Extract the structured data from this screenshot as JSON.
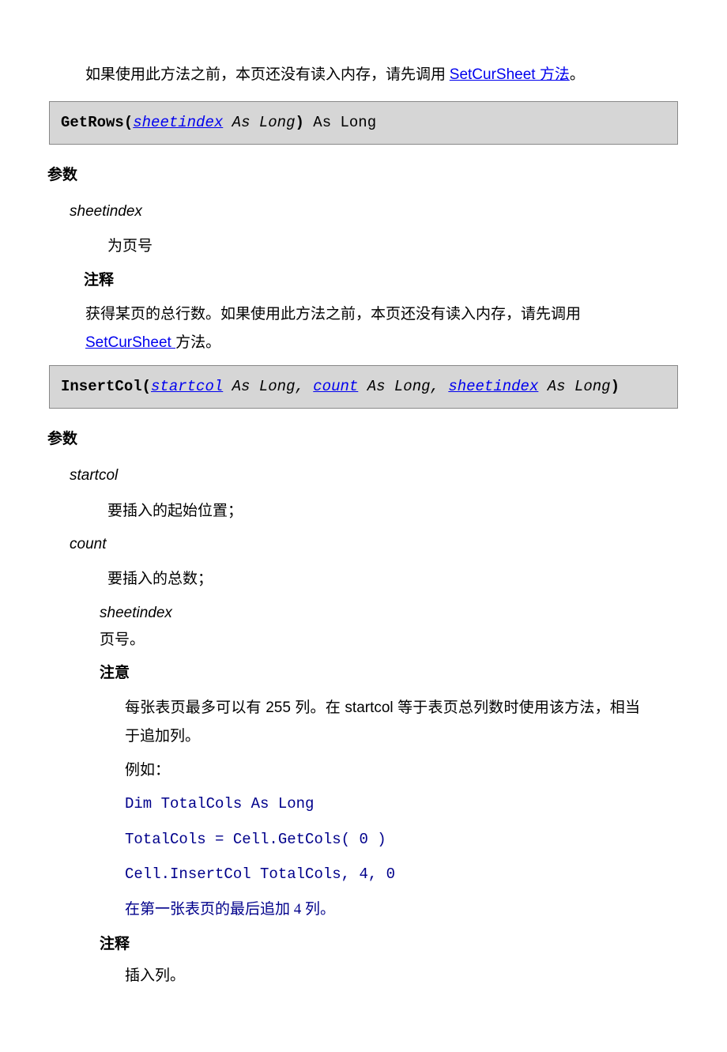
{
  "intro": {
    "text_before_link": "如果使用此方法之前，本页还没有读入内存，请先调用 ",
    "link_text": "SetCurSheet 方法",
    "text_after_link": "。"
  },
  "method1": {
    "name": "GetRows",
    "param1": "sheetindex",
    "type1": " As Long",
    "ret": " As Long"
  },
  "section_params": "参数",
  "m1_params": {
    "p1_name": "sheetindex",
    "p1_desc": "为页号"
  },
  "section_remarks": "注释",
  "m1_remark": {
    "pre": "获得某页的总行数。如果使用此方法之前，本页还没有读入内存，请先调用",
    "link": "SetCurSheet ",
    "post": "方法。"
  },
  "method2": {
    "name": "InsertCol",
    "p1": "startcol",
    "t1": " As Long, ",
    "p2": "count",
    "t2": " As Long, ",
    "p3": "sheetindex",
    "t3": " As Long"
  },
  "m2_params": {
    "p1_name": "startcol",
    "p1_desc": "要插入的起始位置；",
    "p2_name": "count",
    "p2_desc": "要插入的总数；",
    "p3_name": "sheetindex",
    "p3_desc": "页号。"
  },
  "section_attention": "注意",
  "m2_attention": "每张表页最多可以有 255 列。在 startcol 等于表页总列数时使用该方法，相当于追加列。",
  "example_label": "例如：",
  "example": {
    "l1": "Dim TotalCols As Long",
    "l2": "TotalCols = Cell.GetCols( 0 )",
    "l3": "Cell.InsertCol TotalCols, 4, 0",
    "note": "在第一张表页的最后追加 4 列。"
  },
  "m2_remark": "插入列。"
}
